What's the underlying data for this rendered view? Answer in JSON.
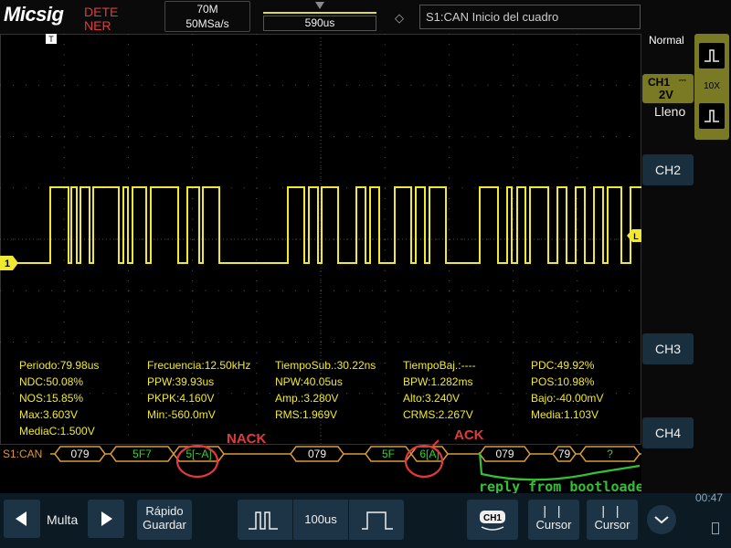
{
  "header": {
    "logo": "Micsig",
    "mode_text": "DETE NER",
    "memory_depth": "70M",
    "sample_rate": "50MSa/s",
    "trigger_position": "590us",
    "trigger_info": "S1:CAN Inicio del cuadro"
  },
  "markers": {
    "trigger_top": "T",
    "channel": "1",
    "level": "L"
  },
  "measurements": [
    [
      "Periodo:79.98us",
      "Frecuencia:12.50kHz",
      "TiempoSub.:30.22ns",
      "TiempoBaj.:----",
      "PDC:49.92%"
    ],
    [
      "NDC:50.08%",
      "PPW:39.93us",
      "NPW:40.05us",
      "BPW:1.282ms",
      "POS:10.98%"
    ],
    [
      "NOS:15.85%",
      "PKPK:4.160V",
      "Amp.:3.280V",
      "Alto:3.240V",
      "Bajo:-40.00mV"
    ],
    [
      "Max:3.603V",
      "Min:-560.0mV",
      "RMS:1.969V",
      "CRMS:2.267V",
      "Media:1.103V"
    ],
    [
      "MediaC:1.500V"
    ]
  ],
  "decode": {
    "label": "S1:CAN",
    "frames": [
      "079",
      "5F7",
      "5[~A]",
      "079",
      "5F",
      "6[A]",
      "079",
      "79",
      "?"
    ]
  },
  "annotations": {
    "nack": "NACK",
    "ack": "ACK",
    "reply": "reply from bootloader"
  },
  "right_panel": {
    "trigger_mode": "Normal",
    "probe": "10X",
    "ch1_label": "CH1",
    "ch1_scale": "2V",
    "fill": "Lleno",
    "ch2": "CH2",
    "ch3": "CH3",
    "ch4": "CH4"
  },
  "bottom": {
    "multa": "Multa",
    "quick_save_line1": "Rápido",
    "quick_save_line2": "Guardar",
    "timebase": "100us",
    "ch1_badge": "CH1",
    "cursor1": "Cursor",
    "cursor2": "Cursor",
    "clock": "00:47"
  },
  "colors": {
    "trace": "#f0e930",
    "decode": "#d99a3a",
    "decode_text": "#35d035",
    "annotation_red": "#e23a3a",
    "annotation_green": "#35c035",
    "button_bg": "#1c3446"
  }
}
